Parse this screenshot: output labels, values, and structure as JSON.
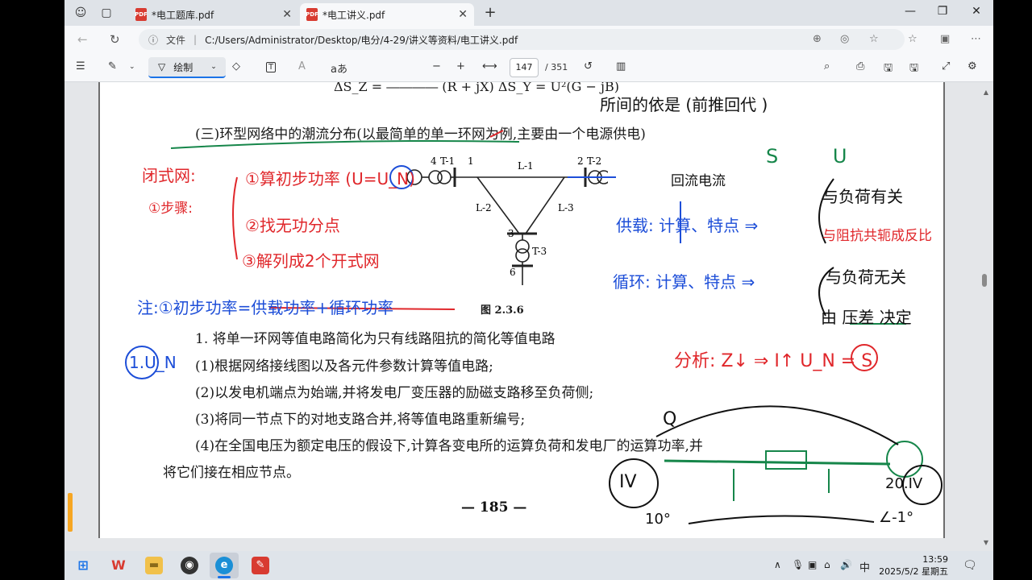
{
  "browser": {
    "tabs": [
      {
        "label": "*电工题库.pdf",
        "active": false
      },
      {
        "label": "*电工讲义.pdf",
        "active": true
      }
    ],
    "new_tab": "+",
    "address": {
      "file_label": "文件",
      "url": "C:/Users/Administrator/Desktop/电分/4-29/讲义等资料/电工讲义.pdf"
    }
  },
  "pdf_toolbar": {
    "draw_label": "绘制",
    "text_icon": "T",
    "read_aloud_icon": "aあ",
    "zoom_out": "−",
    "zoom_in": "+",
    "current_page": "147",
    "total_pages": "/ 351"
  },
  "document": {
    "formula_line": "ΔS_Z = ―――― (R + jX)          ΔS_Y = U²(G − jB)",
    "section_heading": "(三)环型网络中的潮流分布(以最简单的单一环网为例,主要由一个电源供电)",
    "figure_caption": "图 2.3.6",
    "figure_labels": {
      "node4": "4",
      "t1": "T-1",
      "node1": "1",
      "l1": "L-1",
      "node2": "2",
      "t2": "T-2",
      "node5": "5",
      "l2": "L-2",
      "l3": "L-3",
      "node3": "3",
      "t3": "T-3",
      "node6": "6"
    },
    "step_title": "1. 将单一环网等值电路简化为只有线路阻抗的简化等值电路",
    "steps": [
      "(1)根据网络接线图以及各元件参数计算等值电路;",
      "(2)以发电机端点为始端,并将发电厂变压器的励磁支路移至负荷侧;",
      "(3)将同一节点下的对地支路合并,将等值电路重新编号;",
      "(4)在全国电压为额定电压的假设下,计算各变电所的运算负荷和发电厂的运算功率,并",
      "将它们接在相应节点。"
    ],
    "page_number": "— 185 —"
  },
  "annotations": {
    "top_right": "所间的依是 (前推回代 )",
    "closed_net": "闭式网:",
    "steps_label": "①步骤:",
    "step1": "①算初步功率 (U=U_N)",
    "step2": "②找无功分点",
    "step3": "③解列成2个开式网",
    "note": "注:①初步功率=供载功率+循环功率",
    "sv": "S  U",
    "loop_current": "回流电流",
    "load_row": "供载: 计算、特点 ⇒",
    "loop_row": "循环: 计算、特点 ⇒",
    "related": "与负荷有关",
    "impedance": "与阻抗共轭成反比",
    "unrelated": "与负荷无关",
    "voltage_diff": "由 压差 决定",
    "ui_label": "1.U_N",
    "analysis": "分析: Z↓ ⇒ I↑ U_N = S",
    "gen_left": "IV",
    "gen_right": "20.IV",
    "angle_left": "10°",
    "angle_right": "∠-1°",
    "q_label": "Q"
  },
  "taskbar": {
    "time": "13:59",
    "date": "2025/5/2 星期五",
    "ime": "中"
  },
  "colors": {
    "ink_red": "#e0272b",
    "ink_blue": "#1d4ed8",
    "ink_green": "#16864a",
    "accent": "#1a73e8"
  }
}
